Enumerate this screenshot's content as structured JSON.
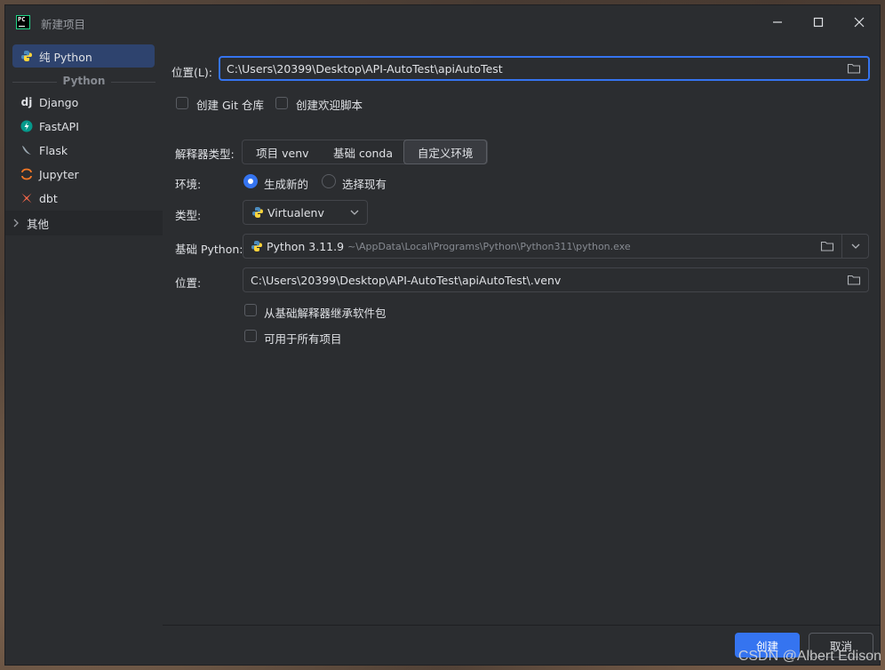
{
  "window": {
    "title": "新建项目",
    "app_logo_text": "PC"
  },
  "sidebar": {
    "selected": {
      "label": "纯 Python"
    },
    "group_label": "Python",
    "items": [
      {
        "label": "Django",
        "icon": "django-icon"
      },
      {
        "label": "FastAPI",
        "icon": "fastapi-icon"
      },
      {
        "label": "Flask",
        "icon": "flask-icon"
      },
      {
        "label": "Jupyter",
        "icon": "jupyter-icon"
      },
      {
        "label": "dbt",
        "icon": "dbt-icon"
      }
    ],
    "other": {
      "label": "其他"
    }
  },
  "form": {
    "location_label": "位置(L):",
    "location_value": "C:\\Users\\20399\\Desktop\\API-AutoTest\\apiAutoTest",
    "git_label": "创建 Git 仓库",
    "welcome_label": "创建欢迎脚本",
    "interpreter_type_label": "解释器类型:",
    "interpreter_types": [
      "项目 venv",
      "基础 conda",
      "自定义环境"
    ],
    "interpreter_selected": "自定义环境",
    "env_label": "环境:",
    "env_new": "生成新的",
    "env_existing": "选择现有",
    "type_label": "类型:",
    "type_value": "Virtualenv",
    "base_python_label": "基础 Python:",
    "base_python_version": "Python 3.11.9",
    "base_python_path": "~\\AppData\\Local\\Programs\\Python\\Python311\\python.exe",
    "venv_location_label": "位置:",
    "venv_location_value": "C:\\Users\\20399\\Desktop\\API-AutoTest\\apiAutoTest\\.venv",
    "inherit_label": "从基础解释器继承软件包",
    "all_projects_label": "可用于所有项目"
  },
  "footer": {
    "create_label": "创建",
    "cancel_label": "取消"
  },
  "watermark": "CSDN @Albert Edison",
  "colors": {
    "background": "#2b2d30",
    "accent": "#3574f0",
    "selected": "#2e436e",
    "border": "#43454a",
    "text": "#dfe1e5"
  }
}
